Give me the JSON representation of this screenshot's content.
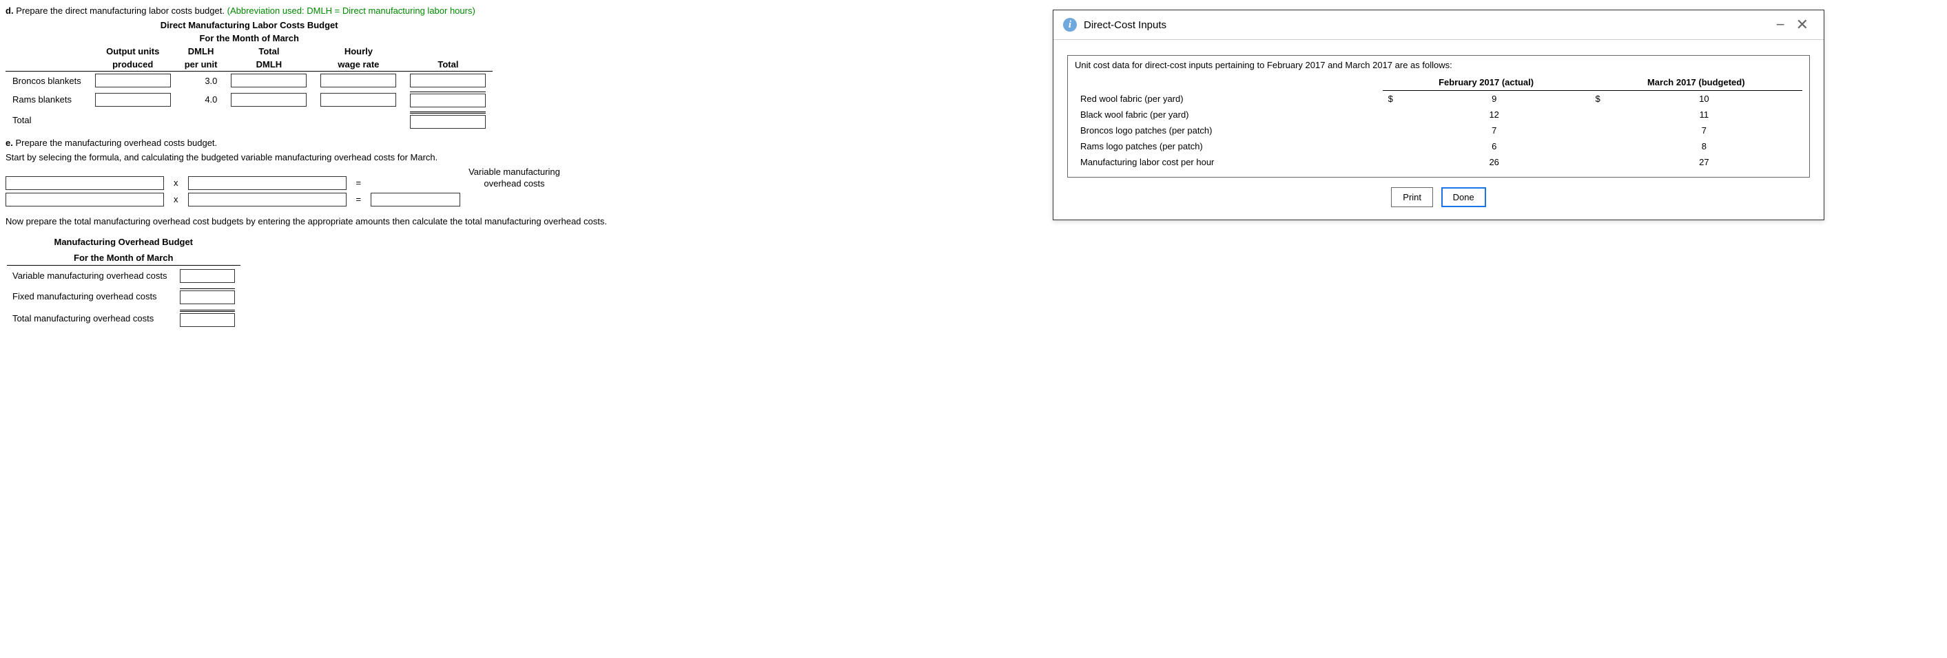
{
  "part_d": {
    "label": "d.",
    "text": "Prepare the direct manufacturing labor costs budget.",
    "abbrev": "(Abbreviation used: DMLH = Direct manufacturing labor hours)",
    "title": "Direct Manufacturing Labor Costs Budget",
    "subtitle": "For the Month of March",
    "cols": {
      "c1a": "Output units",
      "c1b": "produced",
      "c2a": "DMLH",
      "c2b": "per unit",
      "c3a": "Total",
      "c3b": "DMLH",
      "c4a": "Hourly",
      "c4b": "wage rate",
      "c5b": "Total"
    },
    "rows": {
      "r1": {
        "name": "Broncos blankets",
        "dmlh": "3.0"
      },
      "r2": {
        "name": "Rams blankets",
        "dmlh": "4.0"
      },
      "total": "Total"
    }
  },
  "part_e": {
    "label": "e.",
    "text": "Prepare the manufacturing overhead costs budget.",
    "instr": "Start by selecing the formula, and calculating the budgeted variable manufacturing overhead costs for March.",
    "result_line1": "Variable manufacturing",
    "result_line2": "overhead costs",
    "instr2": "Now prepare the total manufacturing overhead cost budgets by entering the appropriate amounts then calculate the total manufacturing overhead costs.",
    "ovhd_title": "Manufacturing Overhead Budget",
    "ovhd_subtitle": "For the Month of March",
    "ovhd_rows": {
      "var": "Variable manufacturing overhead costs",
      "fixed": "Fixed manufacturing overhead costs",
      "total": "Total manufacturing overhead costs"
    }
  },
  "dialog": {
    "title": "Direct-Cost Inputs",
    "intro": "Unit cost data for direct-cost inputs pertaining to February 2017 and March 2017 are as follows:",
    "col_feb": "February 2017 (actual)",
    "col_mar": "March 2017 (budgeted)",
    "currency": "$",
    "rows": [
      {
        "name": "Red wool fabric (per yard)",
        "feb": "9",
        "mar": "10"
      },
      {
        "name": "Black wool fabric (per yard)",
        "feb": "12",
        "mar": "11"
      },
      {
        "name": "Broncos logo patches (per patch)",
        "feb": "7",
        "mar": "7"
      },
      {
        "name": "Rams logo patches (per patch)",
        "feb": "6",
        "mar": "8"
      },
      {
        "name": "Manufacturing labor cost per hour",
        "feb": "26",
        "mar": "27"
      }
    ],
    "btn_print": "Print",
    "btn_done": "Done"
  },
  "ops": {
    "x": "x",
    "eq": "="
  }
}
